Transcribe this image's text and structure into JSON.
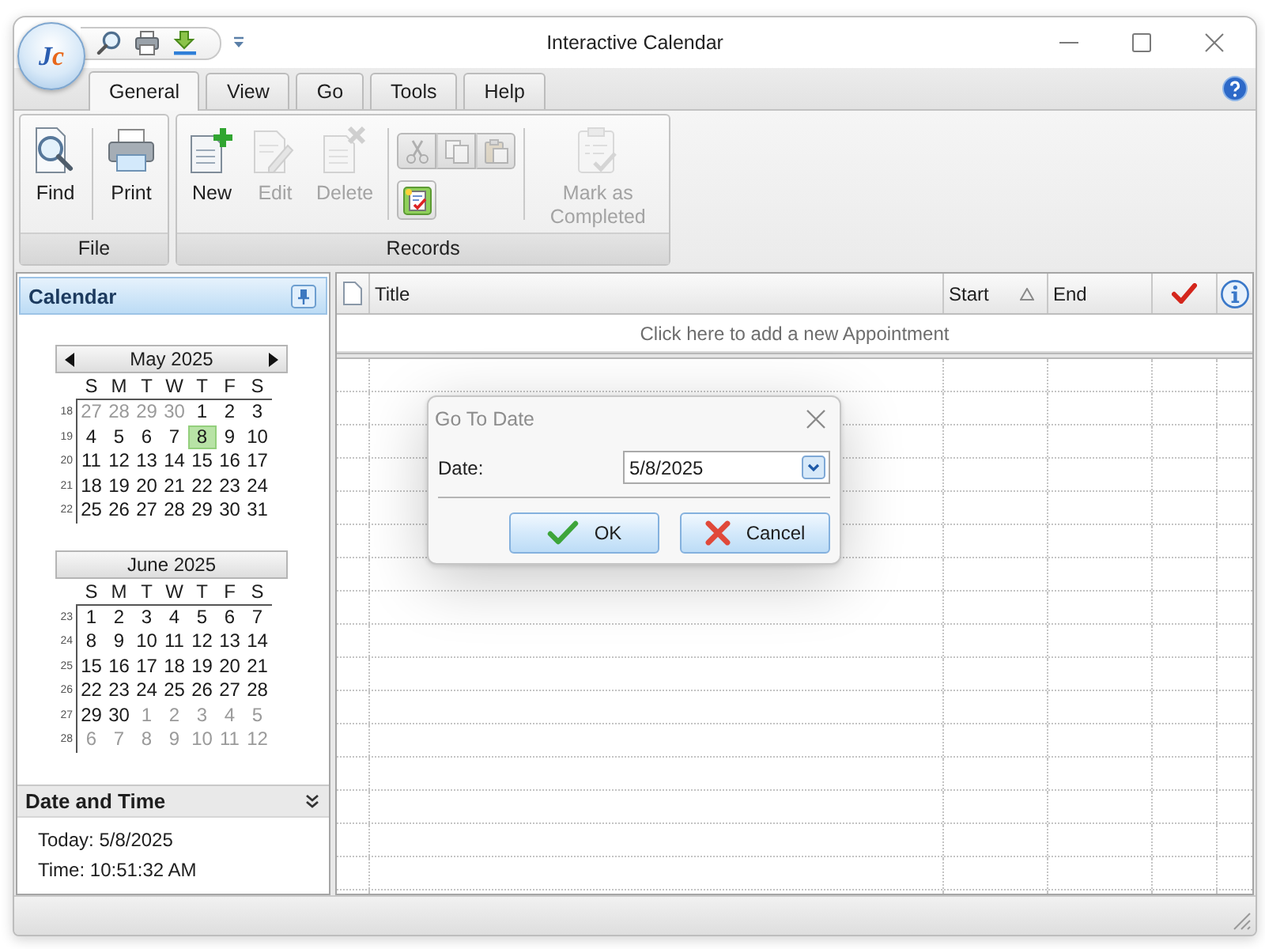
{
  "window": {
    "title": "Interactive Calendar",
    "logo": "Jc"
  },
  "tabs": [
    {
      "label": "General",
      "selected": true
    },
    {
      "label": "View",
      "selected": false
    },
    {
      "label": "Go",
      "selected": false
    },
    {
      "label": "Tools",
      "selected": false
    },
    {
      "label": "Help",
      "selected": false
    }
  ],
  "ribbon": {
    "groups": [
      {
        "label": "File",
        "sections": [
          {
            "kind": "large",
            "buttons": [
              {
                "label": "Find",
                "disabled": false
              }
            ]
          },
          {
            "kind": "large",
            "buttons": [
              {
                "label": "Print",
                "disabled": false
              }
            ]
          }
        ]
      },
      {
        "label": "Records",
        "sections": [
          {
            "kind": "large",
            "buttons": [
              {
                "label": "New",
                "disabled": false
              },
              {
                "label": "Edit",
                "disabled": true
              },
              {
                "label": "Delete",
                "disabled": true
              }
            ]
          },
          {
            "kind": "small",
            "rows": [
              [
                {
                  "disabled": true
                },
                {
                  "disabled": true
                },
                {
                  "disabled": true
                }
              ],
              [
                {
                  "disabled": false
                }
              ]
            ]
          },
          {
            "kind": "large",
            "buttons": [
              {
                "label": "Mark as Completed",
                "disabled": true
              }
            ]
          }
        ]
      }
    ]
  },
  "calendar": {
    "title": "Calendar",
    "months": [
      {
        "title": "May 2025",
        "weekdays": [
          "S",
          "M",
          "T",
          "W",
          "T",
          "F",
          "S"
        ],
        "weeks": [
          {
            "number": "18",
            "days": [
              {
                "day": "27",
                "other_month": true,
                "selected": false
              },
              {
                "day": "28",
                "other_month": true,
                "selected": false
              },
              {
                "day": "29",
                "other_month": true,
                "selected": false
              },
              {
                "day": "30",
                "other_month": true,
                "selected": false
              },
              {
                "day": "1",
                "other_month": false,
                "selected": false
              },
              {
                "day": "2",
                "other_month": false,
                "selected": false
              },
              {
                "day": "3",
                "other_month": false,
                "selected": false
              }
            ]
          },
          {
            "number": "19",
            "days": [
              {
                "day": "4",
                "other_month": false,
                "selected": false
              },
              {
                "day": "5",
                "other_month": false,
                "selected": false
              },
              {
                "day": "6",
                "other_month": false,
                "selected": false
              },
              {
                "day": "7",
                "other_month": false,
                "selected": false
              },
              {
                "day": "8",
                "other_month": false,
                "selected": true
              },
              {
                "day": "9",
                "other_month": false,
                "selected": false
              },
              {
                "day": "10",
                "other_month": false,
                "selected": false
              }
            ]
          },
          {
            "number": "20",
            "days": [
              {
                "day": "11",
                "other_month": false,
                "selected": false
              },
              {
                "day": "12",
                "other_month": false,
                "selected": false
              },
              {
                "day": "13",
                "other_month": false,
                "selected": false
              },
              {
                "day": "14",
                "other_month": false,
                "selected": false
              },
              {
                "day": "15",
                "other_month": false,
                "selected": false
              },
              {
                "day": "16",
                "other_month": false,
                "selected": false
              },
              {
                "day": "17",
                "other_month": false,
                "selected": false
              }
            ]
          },
          {
            "number": "21",
            "days": [
              {
                "day": "18",
                "other_month": false,
                "selected": false
              },
              {
                "day": "19",
                "other_month": false,
                "selected": false
              },
              {
                "day": "20",
                "other_month": false,
                "selected": false
              },
              {
                "day": "21",
                "other_month": false,
                "selected": false
              },
              {
                "day": "22",
                "other_month": false,
                "selected": false
              },
              {
                "day": "23",
                "other_month": false,
                "selected": false
              },
              {
                "day": "24",
                "other_month": false,
                "selected": false
              }
            ]
          },
          {
            "number": "22",
            "days": [
              {
                "day": "25",
                "other_month": false,
                "selected": false
              },
              {
                "day": "26",
                "other_month": false,
                "selected": false
              },
              {
                "day": "27",
                "other_month": false,
                "selected": false
              },
              {
                "day": "28",
                "other_month": false,
                "selected": false
              },
              {
                "day": "29",
                "other_month": false,
                "selected": false
              },
              {
                "day": "30",
                "other_month": false,
                "selected": false
              },
              {
                "day": "31",
                "other_month": false,
                "selected": false
              }
            ]
          }
        ]
      },
      {
        "title": "June 2025",
        "weekdays": [
          "S",
          "M",
          "T",
          "W",
          "T",
          "F",
          "S"
        ],
        "weeks": [
          {
            "number": "23",
            "days": [
              {
                "day": "1",
                "other_month": false,
                "selected": false
              },
              {
                "day": "2",
                "other_month": false,
                "selected": false
              },
              {
                "day": "3",
                "other_month": false,
                "selected": false
              },
              {
                "day": "4",
                "other_month": false,
                "selected": false
              },
              {
                "day": "5",
                "other_month": false,
                "selected": false
              },
              {
                "day": "6",
                "other_month": false,
                "selected": false
              },
              {
                "day": "7",
                "other_month": false,
                "selected": false
              }
            ]
          },
          {
            "number": "24",
            "days": [
              {
                "day": "8",
                "other_month": false,
                "selected": false
              },
              {
                "day": "9",
                "other_month": false,
                "selected": false
              },
              {
                "day": "10",
                "other_month": false,
                "selected": false
              },
              {
                "day": "11",
                "other_month": false,
                "selected": false
              },
              {
                "day": "12",
                "other_month": false,
                "selected": false
              },
              {
                "day": "13",
                "other_month": false,
                "selected": false
              },
              {
                "day": "14",
                "other_month": false,
                "selected": false
              }
            ]
          },
          {
            "number": "25",
            "days": [
              {
                "day": "15",
                "other_month": false,
                "selected": false
              },
              {
                "day": "16",
                "other_month": false,
                "selected": false
              },
              {
                "day": "17",
                "other_month": false,
                "selected": false
              },
              {
                "day": "18",
                "other_month": false,
                "selected": false
              },
              {
                "day": "19",
                "other_month": false,
                "selected": false
              },
              {
                "day": "20",
                "other_month": false,
                "selected": false
              },
              {
                "day": "21",
                "other_month": false,
                "selected": false
              }
            ]
          },
          {
            "number": "26",
            "days": [
              {
                "day": "22",
                "other_month": false,
                "selected": false
              },
              {
                "day": "23",
                "other_month": false,
                "selected": false
              },
              {
                "day": "24",
                "other_month": false,
                "selected": false
              },
              {
                "day": "25",
                "other_month": false,
                "selected": false
              },
              {
                "day": "26",
                "other_month": false,
                "selected": false
              },
              {
                "day": "27",
                "other_month": false,
                "selected": false
              },
              {
                "day": "28",
                "other_month": false,
                "selected": false
              }
            ]
          },
          {
            "number": "27",
            "days": [
              {
                "day": "29",
                "other_month": false,
                "selected": false
              },
              {
                "day": "30",
                "other_month": false,
                "selected": false
              },
              {
                "day": "1",
                "other_month": true,
                "selected": false
              },
              {
                "day": "2",
                "other_month": true,
                "selected": false
              },
              {
                "day": "3",
                "other_month": true,
                "selected": false
              },
              {
                "day": "4",
                "other_month": true,
                "selected": false
              },
              {
                "day": "5",
                "other_month": true,
                "selected": false
              }
            ]
          },
          {
            "number": "28",
            "days": [
              {
                "day": "6",
                "other_month": true,
                "selected": false
              },
              {
                "day": "7",
                "other_month": true,
                "selected": false
              },
              {
                "day": "8",
                "other_month": true,
                "selected": false
              },
              {
                "day": "9",
                "other_month": true,
                "selected": false
              },
              {
                "day": "10",
                "other_month": true,
                "selected": false
              },
              {
                "day": "11",
                "other_month": true,
                "selected": false
              },
              {
                "day": "12",
                "other_month": true,
                "selected": false
              }
            ]
          }
        ]
      }
    ]
  },
  "date_time": {
    "title": "Date and Time",
    "lines": [
      "Today: 5/8/2025",
      "Time: 10:51:32 AM"
    ]
  },
  "appointments": {
    "columns": [
      {
        "kind": "icon"
      },
      {
        "kind": "text",
        "label": "Title",
        "sorted": false
      },
      {
        "kind": "text",
        "label": "Start",
        "sorted": true
      },
      {
        "kind": "text",
        "label": "End",
        "sorted": false
      },
      {
        "kind": "icon"
      },
      {
        "kind": "icon"
      }
    ],
    "new_row_prompt": "Click here to add a new Appointment"
  },
  "dialog": {
    "title": "Go To Date",
    "field": {
      "label": "Date:",
      "value": "5/8/2025"
    },
    "buttons": [
      {
        "label": "OK",
        "kind": "ok"
      },
      {
        "label": "Cancel",
        "kind": "cancel"
      }
    ]
  }
}
